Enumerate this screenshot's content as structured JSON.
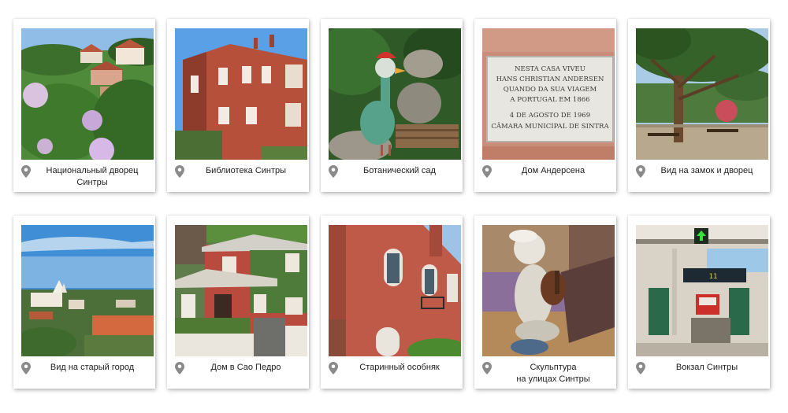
{
  "gallery": {
    "items": [
      {
        "caption": "Национальный дворец\nСинтры",
        "icon": "map-pin-icon"
      },
      {
        "caption": "Библиотека Синтры",
        "icon": "map-pin-icon"
      },
      {
        "caption": "Ботанический сад",
        "icon": "map-pin-icon"
      },
      {
        "caption": "Дом Андерсена",
        "icon": "map-pin-icon"
      },
      {
        "caption": "Вид на замок и дворец",
        "icon": "map-pin-icon"
      },
      {
        "caption": "Вид на старый город",
        "icon": "map-pin-icon"
      },
      {
        "caption": "Дом в Сао Педро",
        "icon": "map-pin-icon"
      },
      {
        "caption": "Старинный особняк",
        "icon": "map-pin-icon"
      },
      {
        "caption": "Скульптура\nна улицах Синтры",
        "icon": "map-pin-icon"
      },
      {
        "caption": "Вокзал Синтры",
        "icon": "map-pin-icon"
      }
    ],
    "plaque_text": [
      "NESTA CASA VIVEU",
      "HANS CHRISTIAN ANDERSEN",
      "QUANDO DA SUA VIAGEM",
      "A PORTUGAL EM 1866",
      "4 DE AGOSTO DE 1969",
      "CÂMARA MUNICIPAL DE SINTRA"
    ],
    "station_sign_text": "11",
    "colors": {
      "pin": "#8a8a8a",
      "caption_text": "#222222",
      "card_bg": "#ffffff"
    }
  }
}
